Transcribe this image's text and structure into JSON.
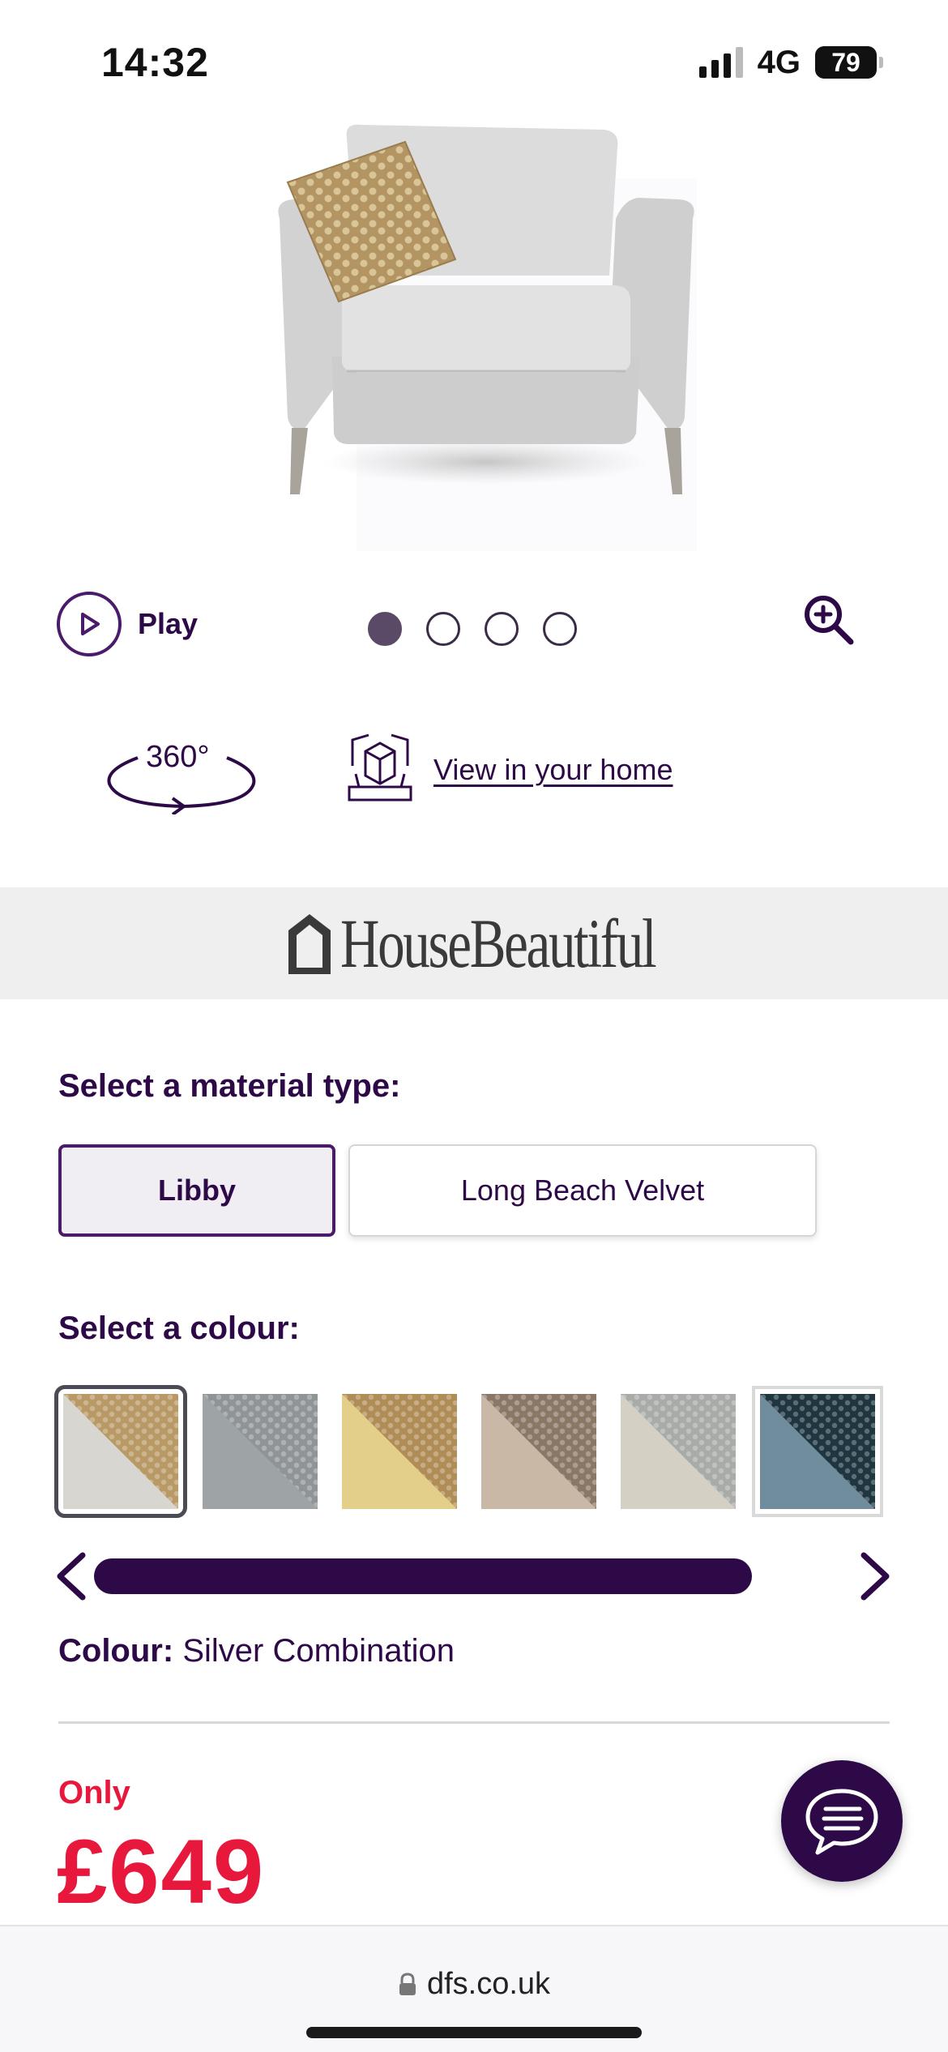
{
  "status_bar": {
    "time": "14:32",
    "network": "4G",
    "battery": "79"
  },
  "media": {
    "play_label": "Play",
    "dots": [
      true,
      false,
      false,
      false
    ],
    "view_360_label": "360°",
    "view_in_home_label": "View in your home"
  },
  "banner": {
    "brand": "HouseBeautiful"
  },
  "material": {
    "heading": "Select a material type:",
    "options": [
      "Libby",
      "Long Beach Velvet"
    ],
    "selected": "Libby"
  },
  "colour": {
    "heading": "Select a colour:",
    "swatches": [
      {
        "name": "silver-combination",
        "pattern": "#b99a66",
        "plain": "#d8d6d0",
        "selected": true
      },
      {
        "name": "grey-pattern",
        "pattern": "#8f9497",
        "plain": "#9ea3a5",
        "selected": false
      },
      {
        "name": "gold-combination",
        "pattern": "#b08d57",
        "plain": "#e3cf8a",
        "selected": false
      },
      {
        "name": "mink",
        "pattern": "#8b7766",
        "plain": "#c9b8a6",
        "selected": false
      },
      {
        "name": "natural",
        "pattern": "#a8aba8",
        "plain": "#d4d0c4",
        "selected": false
      },
      {
        "name": "teal-combination",
        "pattern": "#1f3540",
        "plain": "#6f8d9c",
        "selected": false
      }
    ],
    "label": "Colour:",
    "value": "Silver Combination"
  },
  "price": {
    "only_label": "Only",
    "amount": "£649"
  },
  "browser": {
    "url": "dfs.co.uk"
  },
  "colors": {
    "brand_purple": "#2d0a47",
    "price_red": "#e8173c"
  }
}
